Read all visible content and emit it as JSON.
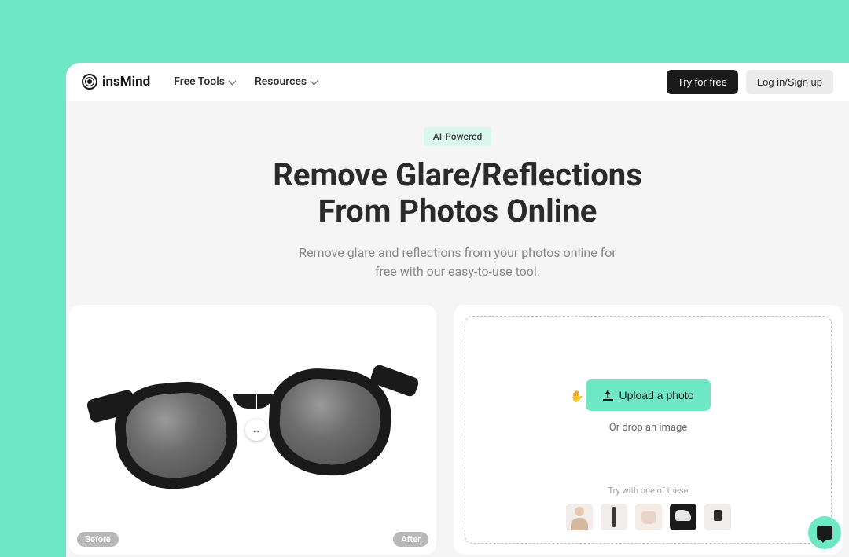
{
  "brand": {
    "name": "insMind"
  },
  "nav": {
    "items": [
      {
        "label": "Free Tools"
      },
      {
        "label": "Resources"
      }
    ],
    "try_free": "Try for free",
    "login": "Log in/Sign up"
  },
  "hero": {
    "badge": "AI-Powered",
    "title_line1": "Remove Glare/Reflections",
    "title_line2": "From Photos Online",
    "subtitle_line1": "Remove glare and reflections from your photos online for",
    "subtitle_line2": "free with our easy-to-use tool."
  },
  "compare": {
    "before_label": "Before",
    "after_label": "After",
    "slider_glyph": "↔"
  },
  "upload": {
    "button_label": "Upload a photo",
    "drop_text": "Or drop an image",
    "try_label": "Try with one of these",
    "cursor": "✋"
  }
}
